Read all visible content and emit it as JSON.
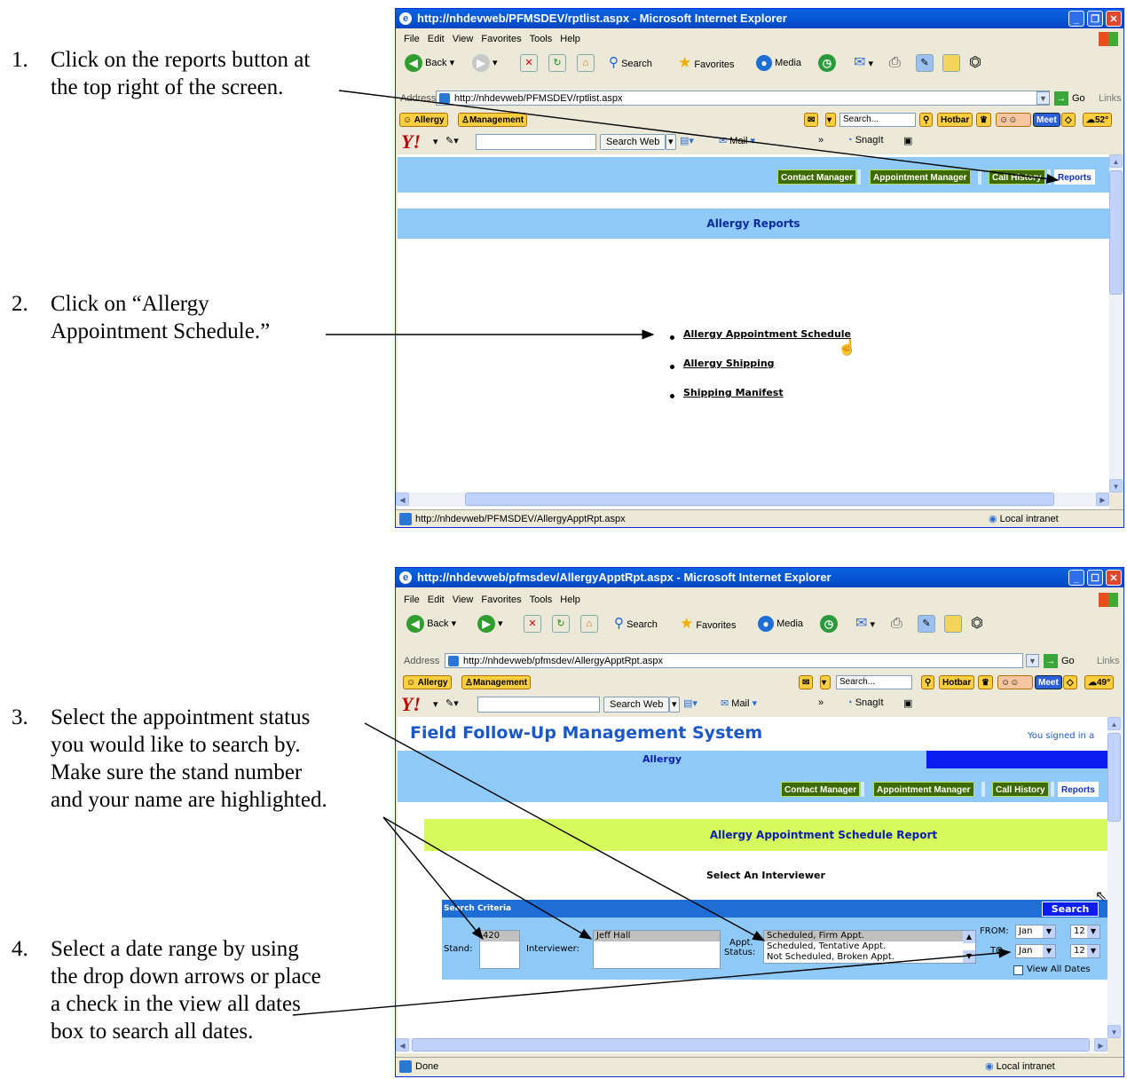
{
  "instructions": [
    {
      "num": "1.",
      "text": "Click on the reports button at\nthe top right of the screen."
    },
    {
      "num": "2.",
      "text": "Click on “Allergy\nAppointment Schedule.”"
    },
    {
      "num": "3.",
      "text": "Select the appointment status\nyou would like to search by.\nMake sure the stand number\nand your name are highlighted."
    },
    {
      "num": "4.",
      "text": "Select a date range by using\nthe drop down arrows or place\na check in the view all dates\nbox to search all dates."
    }
  ],
  "menus": [
    "File",
    "Edit",
    "View",
    "Favorites",
    "Tools",
    "Help"
  ],
  "toolbar": {
    "back": "Back",
    "search": "Search",
    "favorites": "Favorites",
    "media": "Media"
  },
  "address_label": "Address",
  "go_label": "Go",
  "links_label": "Links",
  "bar1": {
    "allergy": "Allergy",
    "management": "Management",
    "search_placeholder": "Search...",
    "hotbar": "Hotbar",
    "meet": "Meet"
  },
  "yahoo": {
    "logo": "Y!",
    "search_web": "Search Web",
    "mail": "Mail",
    "snagit": "SnagIt",
    "more": "»"
  },
  "window1": {
    "title": "http://nhdevweb/PFMSDEV/rptlist.aspx - Microsoft Internet Explorer",
    "address": "http://nhdevweb/PFMSDEV/rptlist.aspx",
    "temp": "52°",
    "nav": [
      "Contact Manager",
      "Appointment Manager",
      "Call History",
      "Reports"
    ],
    "heading": "Allergy Reports",
    "links": [
      "Allergy Appointment Schedule",
      "Allergy Shipping",
      "Shipping Manifest"
    ],
    "status": "http://nhdevweb/PFMSDEV/AllergyApptRpt.aspx",
    "zone": "Local intranet"
  },
  "window2": {
    "title": "http://nhdevweb/pfmsdev/AllergyApptRpt.aspx - Microsoft Internet Explorer",
    "address": "http://nhdevweb/pfmsdev/AllergyApptRpt.aspx",
    "temp": "49°",
    "app_title": "Field Follow-Up Management System",
    "signed_in": "You signed in a",
    "section": "Allergy",
    "nav": [
      "Contact Manager",
      "Appointment Manager",
      "Call History",
      "Reports"
    ],
    "report_title": "Allergy Appointment Schedule Report",
    "select_interviewer": "Select An Interviewer",
    "criteria_title": "Search Criteria",
    "search_button": "Search",
    "stand_label": "Stand:",
    "stand_value": "420",
    "interviewer_label": "Interviewer:",
    "interviewer_value": "Jeff Hall",
    "appt_label_1": "Appt.",
    "appt_label_2": "Status:",
    "appt_options": [
      "Scheduled, Firm Appt.",
      "Scheduled, Tentative Appt.",
      "Not Scheduled, Broken Appt."
    ],
    "from_label": "FROM:",
    "to_label": "TO",
    "from_month": "Jan",
    "from_day": "12",
    "to_month": "Jan",
    "to_day": "12",
    "view_all": "View All Dates",
    "status": "Done",
    "zone": "Local intranet"
  }
}
